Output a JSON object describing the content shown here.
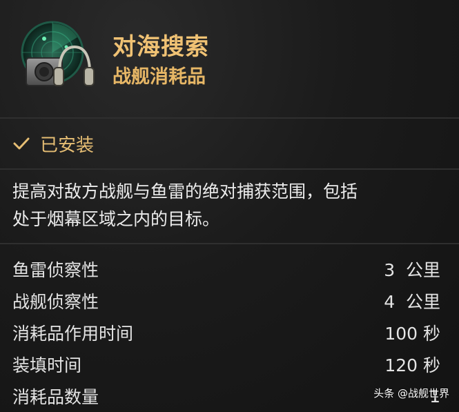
{
  "header": {
    "title": "对海搜索",
    "subtitle": "战舰消耗品",
    "icon": "hydroacoustic-search-icon"
  },
  "status": {
    "installed_label": "已安装",
    "icon": "check-icon"
  },
  "description": {
    "line1": "提高对敌方战舰与鱼雷的绝对捕获范围，包括",
    "line2": "处于烟幕区域之内的目标。"
  },
  "stats": [
    {
      "label": "鱼雷侦察性",
      "value": "3  公里"
    },
    {
      "label": "战舰侦察性",
      "value": "4  公里"
    },
    {
      "label": "消耗品作用时间",
      "value": "100 秒"
    },
    {
      "label": "装填时间",
      "value": "120 秒"
    },
    {
      "label": "消耗品数量",
      "value": "1"
    }
  ],
  "watermark": "头条 @战舰世界",
  "colors": {
    "accent_gold": "#f0c274",
    "background": "#151515",
    "text": "#e9e9e9"
  }
}
